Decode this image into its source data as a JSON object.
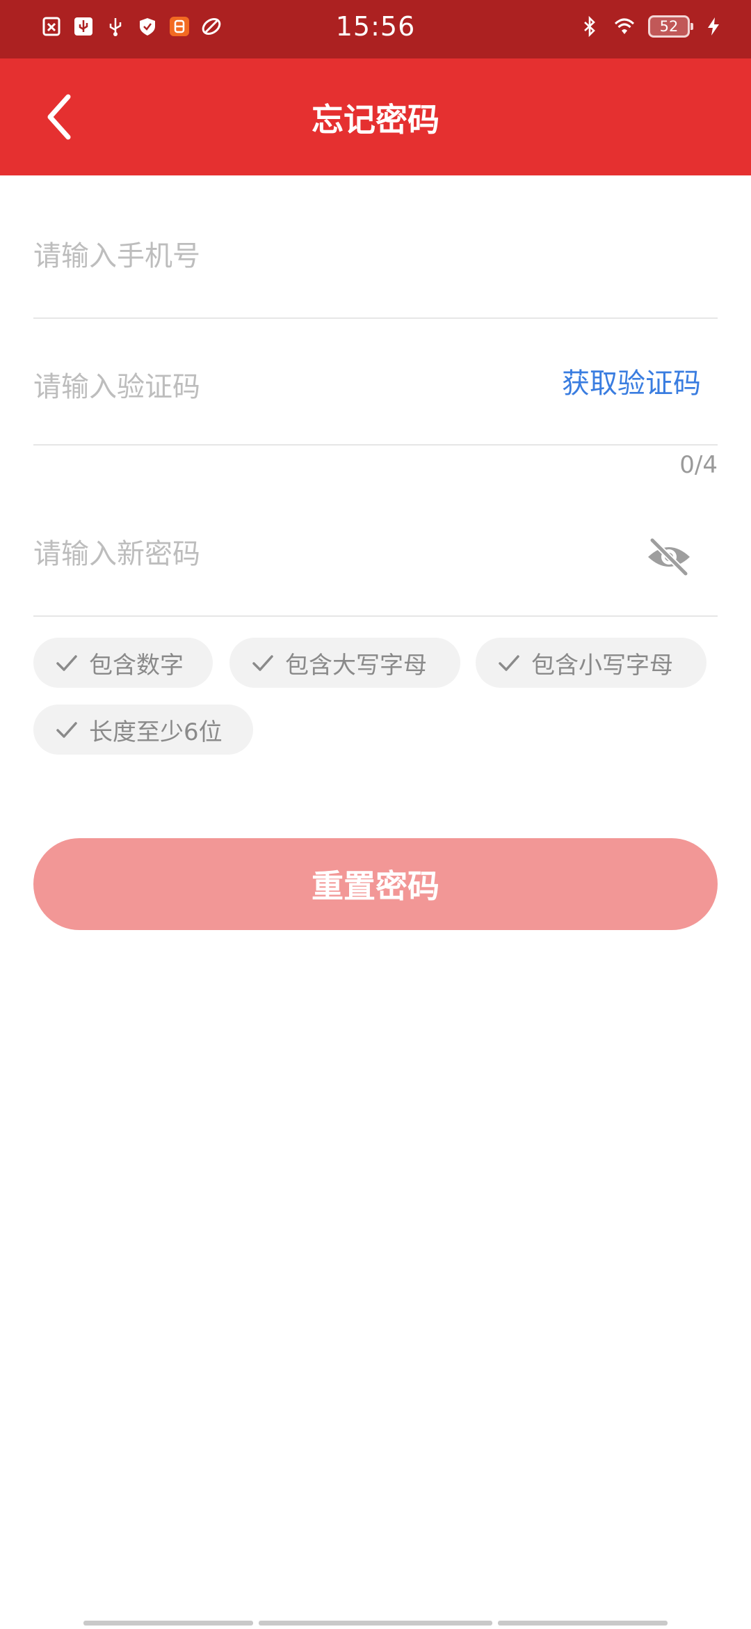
{
  "status_bar": {
    "time": "15:56",
    "battery_level": "52",
    "left_icons": [
      "sim-off-icon",
      "usb-debug-icon",
      "usb-icon",
      "shield-icon",
      "app-notification-icon",
      "link-icon"
    ],
    "right_icons": [
      "bluetooth-icon",
      "wifi-icon",
      "battery-icon",
      "charging-icon"
    ]
  },
  "header": {
    "title": "忘记密码",
    "back_icon": "chevron-left-icon",
    "background_color": "#e53030"
  },
  "form": {
    "phone_placeholder": "请输入手机号",
    "code_placeholder": "请输入验证码",
    "get_code_label": "获取验证码",
    "code_counter": "0/4",
    "password_placeholder": "请输入新密码",
    "password_visibility_icon": "eye-off-icon"
  },
  "requirements": [
    {
      "label": "包含数字",
      "icon": "check-icon"
    },
    {
      "label": "包含大写字母",
      "icon": "check-icon"
    },
    {
      "label": "包含小写字母",
      "icon": "check-icon"
    },
    {
      "label": "长度至少6位",
      "icon": "check-icon"
    }
  ],
  "actions": {
    "reset_label": "重置密码",
    "reset_color": "#f29796"
  },
  "colors": {
    "status_bar": "#ac2121",
    "link": "#3a7de0",
    "chip_background": "#f2f2f2"
  }
}
